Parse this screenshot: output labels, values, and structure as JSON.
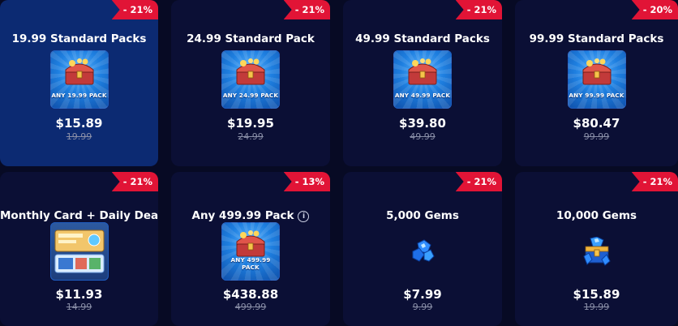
{
  "colors": {
    "page_bg": "#070a24",
    "card_bg": "#0b0f35",
    "card_selected_bg": "#0c2a72",
    "badge_red": "#e11436",
    "old_price": "#8a8fa8"
  },
  "cards": [
    {
      "title": "19.99 Standard Packs",
      "badge": "- 21%",
      "image_caption": "ANY 19.99 PACK",
      "price": "$15.89",
      "old_price": "19.99",
      "selected": true,
      "icon": "treasure-chest-icon"
    },
    {
      "title": "24.99 Standard Pack",
      "badge": "- 21%",
      "image_caption": "ANY 24.99 PACK",
      "price": "$19.95",
      "old_price": "24.99",
      "icon": "treasure-chest-icon"
    },
    {
      "title": "49.99 Standard Packs",
      "badge": "- 21%",
      "image_caption": "ANY 49.99 PACK",
      "price": "$39.80",
      "old_price": "49.99",
      "icon": "treasure-chest-icon"
    },
    {
      "title": "99.99 Standard Packs",
      "badge": "- 20%",
      "image_caption": "ANY 99.99 PACK",
      "price": "$80.47",
      "old_price": "99.99",
      "icon": "treasure-chest-icon"
    },
    {
      "title": "Monthly Card + Daily Deals",
      "badge": "- 21%",
      "image_caption": "",
      "price": "$11.93",
      "old_price": "14.99",
      "icon": "monthly-card-icon"
    },
    {
      "title": "Any 499.99 Pack",
      "badge": "- 13%",
      "image_caption": "ANY 499.99 PACK",
      "price": "$438.88",
      "old_price": "499.99",
      "info_icon": "i",
      "icon": "treasure-chest-icon"
    },
    {
      "title": "5,000 Gems",
      "badge": "- 21%",
      "price": "$7.99",
      "old_price": "9.99",
      "icon": "gem-pile-icon"
    },
    {
      "title": "10,000 Gems",
      "badge": "- 21%",
      "price": "$15.89",
      "old_price": "19.99",
      "icon": "gem-chest-icon"
    }
  ]
}
